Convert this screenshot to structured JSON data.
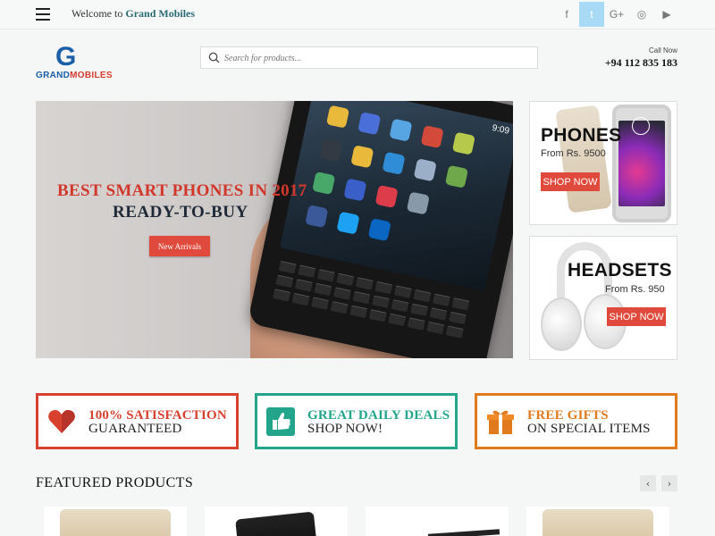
{
  "topbar": {
    "welcome_prefix": "Welcome to ",
    "brand": "Grand Mobiles",
    "social": [
      "facebook-icon",
      "twitter-icon",
      "google-plus-icon",
      "instagram-icon",
      "youtube-icon"
    ],
    "social_glyphs": [
      "f",
      "t",
      "G+",
      "◎",
      "▶"
    ]
  },
  "header": {
    "logo_letter": "G",
    "logo_name_1": "GRAND",
    "logo_name_2": "MOBILES",
    "search_placeholder": "Search for products...",
    "call_label": "Call Now",
    "call_number": "+94 112 835 183"
  },
  "hero": {
    "headline": "BEST SMART PHONES IN 2017",
    "sub": "READY-TO-BUY",
    "cta": "New Arrivals",
    "phone_time": "9:09"
  },
  "promo1": {
    "title": "PHONES",
    "from": "From Rs. 9500",
    "btn": "SHOP NOW"
  },
  "promo2": {
    "title": "HEADSETS",
    "from": "From Rs. 950",
    "btn": "SHOP NOW"
  },
  "features": [
    {
      "line1": "100% SATISFACTION",
      "line2": "GUARANTEED",
      "color": "#d9412f"
    },
    {
      "line1": "GREAT DAILY DEALS",
      "line2": "SHOP NOW!",
      "color": "#22a58a"
    },
    {
      "line1": "FREE GIFTS",
      "line2": "ON SPECIAL ITEMS",
      "color": "#e07a1c"
    }
  ],
  "featured": {
    "title": "FEATURED PRODUCTS",
    "prev": "‹",
    "next": "›"
  }
}
